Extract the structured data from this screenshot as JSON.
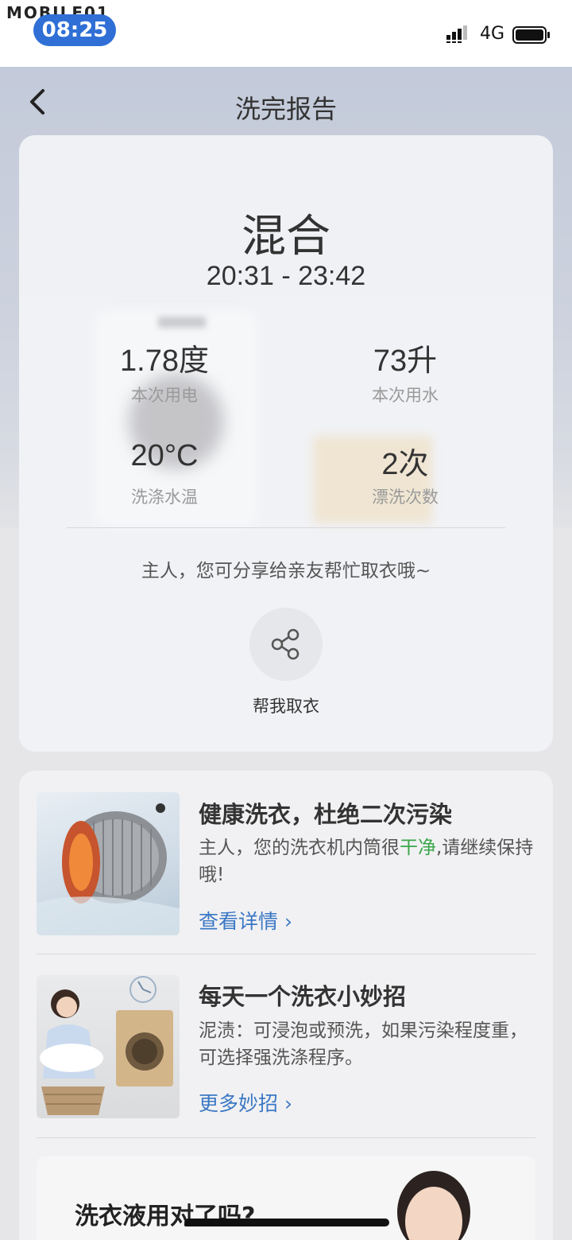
{
  "status_bar": {
    "watermark": "MOBILE01",
    "time": "08:25",
    "network": "4G"
  },
  "header": {
    "title": "洗完报告"
  },
  "report": {
    "program": "混合",
    "time_range": "20:31 - 23:42",
    "stats": [
      {
        "value": "1.78度",
        "label": "本次用电"
      },
      {
        "value": "73升",
        "label": "本次用水"
      },
      {
        "value": "20°C",
        "label": "洗涤水温"
      },
      {
        "value": "2次",
        "label": "漂洗次数"
      }
    ],
    "share_hint": "主人，您可分享给亲友帮忙取衣哦~",
    "share_label": "帮我取衣"
  },
  "tips": [
    {
      "title": "健康洗衣，杜绝二次污染",
      "body_before": "主人，您的洗衣机内筒很",
      "body_highlight": "干净",
      "body_after": ",请继续保持哦!",
      "link": "查看详情 ›"
    },
    {
      "title": "每天一个洗衣小妙招",
      "body": "泥渍：可浸泡或预洗，如果污染程度重，可选择强洗涤程序。",
      "link": "更多妙招 ›"
    }
  ],
  "banner": {
    "title": "洗衣液用对了吗?"
  },
  "colors": {
    "accent_blue": "#3b78c4",
    "time_pill": "#2f6fd6",
    "clean_green": "#3aa64a"
  }
}
